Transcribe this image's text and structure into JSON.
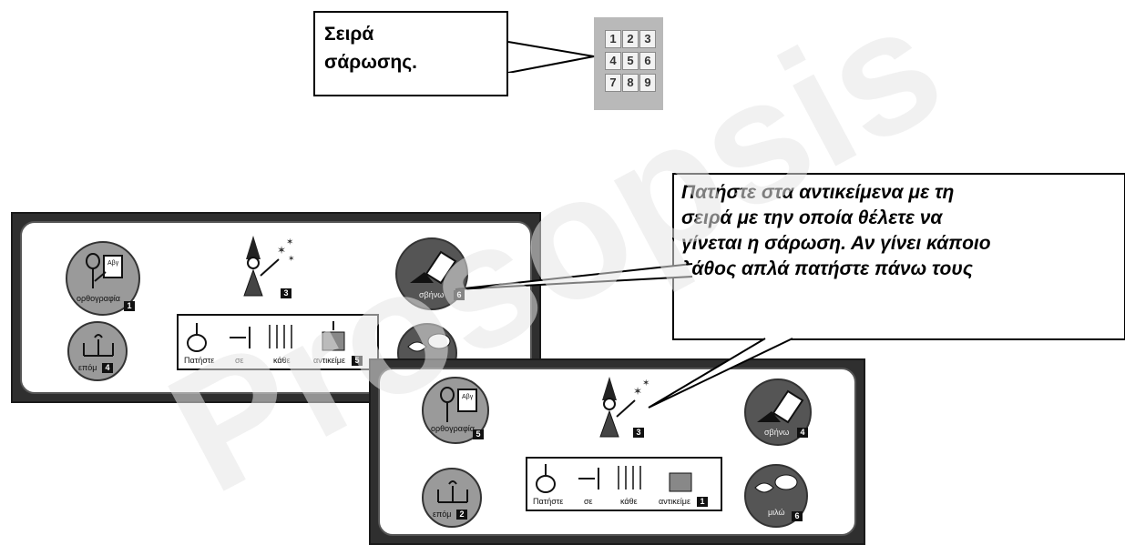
{
  "callouts": {
    "scan_order": [
      "Σειρά",
      "σάρωσης."
    ],
    "instructions": [
      "Πατήστε στα αντικείμενα με τη",
      "σειρά με την οποία θέλετε να",
      "γίνεται η σάρωση. Αν γίνει κάποιο",
      "λάθος απλά πατήστε πάνω τους"
    ]
  },
  "scan_grid": [
    "1",
    "2",
    "3",
    "4",
    "5",
    "6",
    "7",
    "8",
    "9"
  ],
  "panel_a": {
    "spelling": {
      "label": "ορθογραφία",
      "num": "1"
    },
    "next": {
      "label": "επόμ",
      "num": "4"
    },
    "wizard": {
      "num": "3"
    },
    "erase": {
      "label": "σβήνω",
      "num": "6"
    },
    "instruction": {
      "w1": "Πατήστε",
      "w2": "σε",
      "w3": "κάθε",
      "w4": "αντικείμε",
      "num": "5"
    }
  },
  "panel_b": {
    "spelling": {
      "label": "ορθογραφία",
      "num": "5"
    },
    "next": {
      "label": "επόμ",
      "num": "2"
    },
    "wizard": {
      "num": "3"
    },
    "erase": {
      "label": "σβήνω",
      "num": "4"
    },
    "speak": {
      "label": "μιλώ",
      "num": "6"
    },
    "instruction": {
      "w1": "Πατήστε",
      "w2": "σε",
      "w3": "κάθε",
      "w4": "αντικείμε",
      "num": "1"
    }
  },
  "watermark": "Prosopsis"
}
